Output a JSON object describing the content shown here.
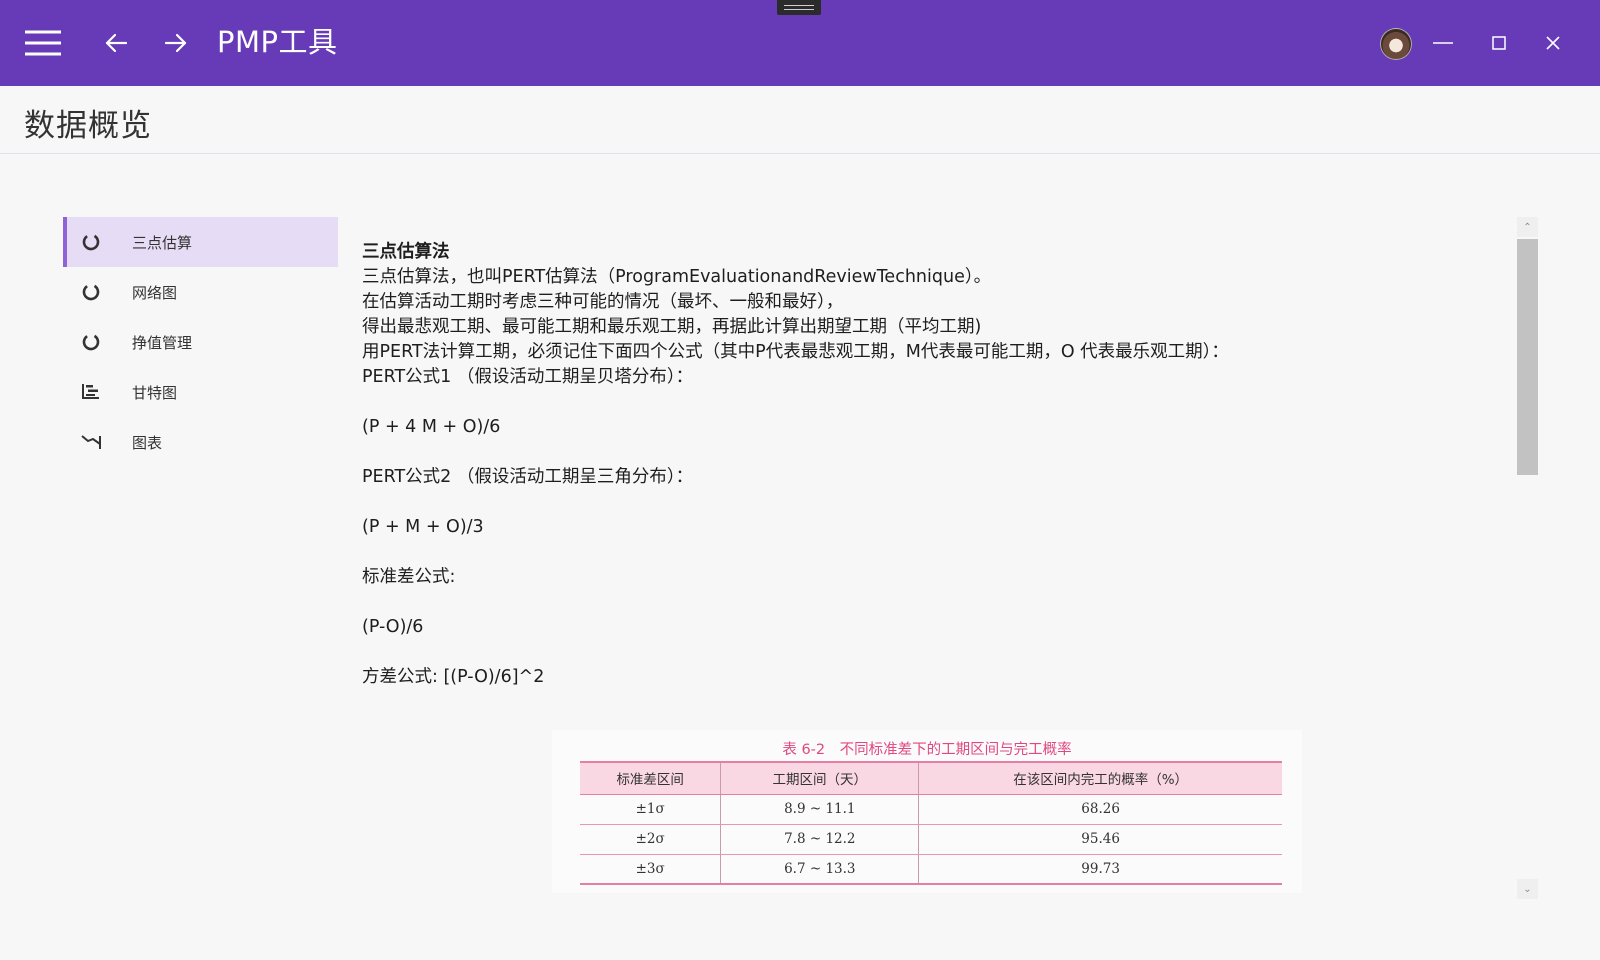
{
  "window": {
    "title": "PMP工具",
    "icons": {
      "menu": "hamburger-menu-icon",
      "back": "arrow-left-icon",
      "forward": "arrow-right-icon",
      "minimize": "minimize-icon",
      "maximize": "maximize-icon",
      "close": "close-icon"
    },
    "accent_color": "#673ab7"
  },
  "page": {
    "title": "数据概览"
  },
  "sidebar": {
    "selected_index": 0,
    "items": [
      {
        "label": "三点估算",
        "icon": "ring-chart-icon"
      },
      {
        "label": "网络图",
        "icon": "ring-chart-icon"
      },
      {
        "label": "挣值管理",
        "icon": "ring-chart-icon"
      },
      {
        "label": "甘特图",
        "icon": "gantt-bars-icon"
      },
      {
        "label": "图表",
        "icon": "line-chart-icon"
      }
    ]
  },
  "content": {
    "heading": "三点估算法",
    "lines": [
      "三点估算法，也叫PERT估算法（ProgramEvaluationandReviewTechnique）。",
      "在估算活动工期时考虑三种可能的情况（最坏、一般和最好），",
      "得出最悲观工期、最可能工期和最乐观工期，再据此计算出期望工期（平均工期)",
      "用PERT法计算工期，必须记住下面四个公式（其中P代表最悲观工期，M代表最可能工期，O 代表最乐观工期）：",
      "PERT公式1 （假设活动工期呈贝塔分布）："
    ],
    "formula1": "(P + 4 M + O)/6",
    "formula2_label": "PERT公式2 （假设活动工期呈三角分布）：",
    "formula2": "(P + M + O)/3",
    "std_label": "标准差公式:",
    "std_formula": "(P-O)/6",
    "variance": "方差公式:  [(P-O)/6]^2"
  },
  "table": {
    "title": "表 6-2　不同标准差下的工期区间与完工概率",
    "headers": [
      "标准差区间",
      "工期区间（天）",
      "在该区间内完工的概率（%）"
    ],
    "rows": [
      [
        "±1σ",
        "8.9 ~ 11.1",
        "68.26"
      ],
      [
        "±2σ",
        "7.8 ~ 12.2",
        "95.46"
      ],
      [
        "±3σ",
        "6.7 ~ 13.3",
        "99.73"
      ]
    ]
  },
  "scrollbar": {
    "up_glyph": "⌃",
    "down_glyph": "⌄",
    "scroll_fraction": 0.0
  }
}
